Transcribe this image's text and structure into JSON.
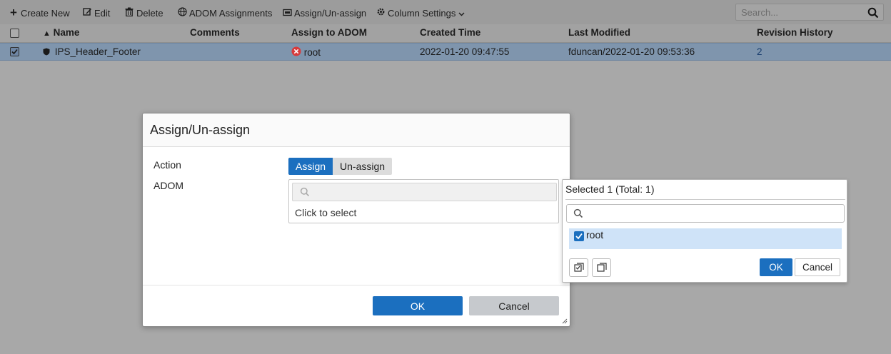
{
  "toolbar": {
    "create_new": "Create New",
    "edit": "Edit",
    "delete": "Delete",
    "adom_assignments": "ADOM Assignments",
    "assign_unassign": "Assign/Un-assign",
    "column_settings": "Column Settings",
    "search_placeholder": "Search..."
  },
  "table": {
    "columns": [
      "Name",
      "Comments",
      "Assign to ADOM",
      "Created Time",
      "Last Modified",
      "Revision History"
    ],
    "sort_indicator": "▲",
    "rows": [
      {
        "name": "IPS_Header_Footer",
        "comments": "",
        "assign_to_adom": "root",
        "created_time": "2022-01-20 09:47:55",
        "last_modified": "fduncan/2022-01-20 09:53:36",
        "revision_history": "2",
        "checked": true
      }
    ]
  },
  "modal": {
    "title": "Assign/Un-assign",
    "action_label": "Action",
    "adom_label": "ADOM",
    "action_options": [
      "Assign",
      "Un-assign"
    ],
    "action_selected": "Assign",
    "adom_placeholder": "Click to select",
    "ok": "OK",
    "cancel": "Cancel"
  },
  "dropdown": {
    "title": "Selected 1 (Total: 1)",
    "items": [
      {
        "label": "root",
        "checked": true
      }
    ],
    "ok": "OK",
    "cancel": "Cancel"
  },
  "colors": {
    "accent": "#1b6fbf",
    "selected_row": "#7f95ad",
    "selected_item": "#cfe3f8",
    "error_red": "#d83a3a"
  }
}
